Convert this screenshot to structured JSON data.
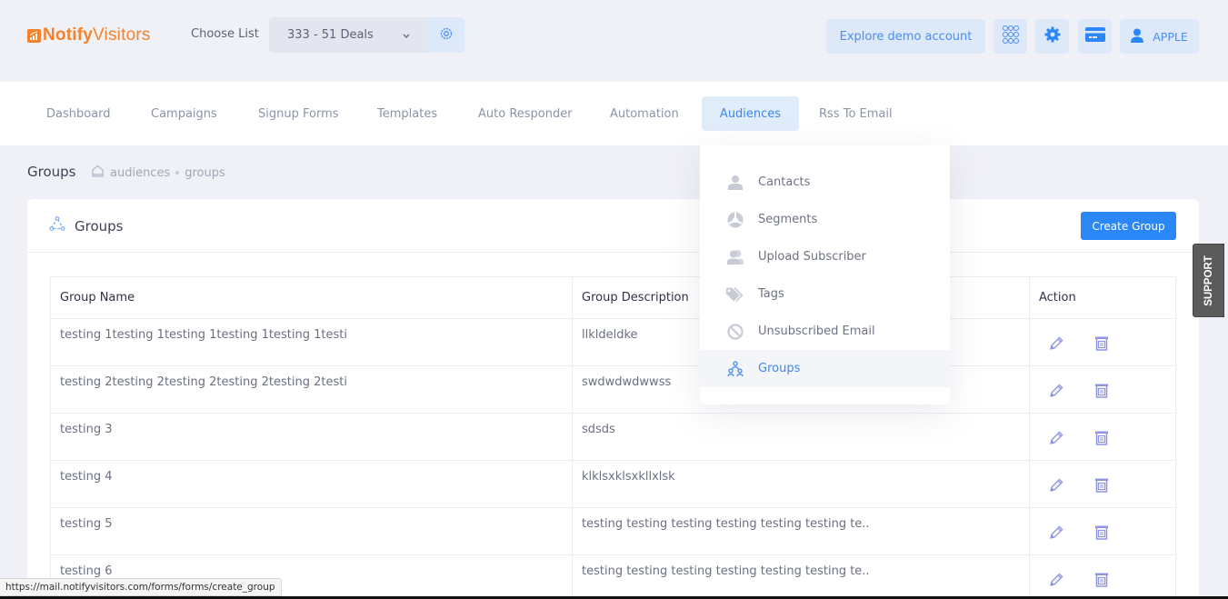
{
  "header": {
    "logo": {
      "bold": "Notify",
      "light": "Visitors",
      "color": "#f5822a"
    },
    "choose_list_label": "Choose List",
    "list_selected": "333 - 51 Deals",
    "demo_button": "Explore demo account",
    "user_name": "APPLE"
  },
  "nav": {
    "items": [
      {
        "label": "Dashboard"
      },
      {
        "label": "Campaigns"
      },
      {
        "label": "Signup Forms"
      },
      {
        "label": "Templates"
      },
      {
        "label": "Auto Responder"
      },
      {
        "label": "Automation"
      },
      {
        "label": "Audiences",
        "active": true
      },
      {
        "label": "Rss To Email"
      }
    ]
  },
  "audiences_menu": {
    "items": [
      {
        "label": "Cantacts",
        "icon": "user-icon"
      },
      {
        "label": "Segments",
        "icon": "segments-icon"
      },
      {
        "label": "Upload Subscriber",
        "icon": "users-icon"
      },
      {
        "label": "Tags",
        "icon": "tags-icon"
      },
      {
        "label": "Unsubscribed Email",
        "icon": "ban-icon"
      },
      {
        "label": "Groups",
        "icon": "groups-icon",
        "active": true
      }
    ]
  },
  "page": {
    "title": "Groups",
    "breadcrumb": [
      "audiences",
      "groups"
    ]
  },
  "card": {
    "title": "Groups",
    "create_button": "Create Group",
    "table": {
      "columns": [
        "Group Name",
        "Group Description",
        "Action"
      ],
      "rows": [
        {
          "name": "testing 1testing 1testing 1testing 1testing 1testi",
          "description": "llkldeldke"
        },
        {
          "name": "testing 2testing 2testing 2testing 2testing 2testi",
          "description": "swdwdwdwwss"
        },
        {
          "name": "testing 3",
          "description": "sdsds"
        },
        {
          "name": "testing 4",
          "description": "klklsxklsxkllxlsk"
        },
        {
          "name": "testing 5",
          "description": "testing testing testing testing testing testing te.."
        },
        {
          "name": "testing 6",
          "description": "testing testing testing testing testing testing te.."
        }
      ]
    }
  },
  "support_tab": "SUPPORT",
  "status_bar_url": "https://mail.notifyvisitors.com/forms/forms/create_group",
  "colors": {
    "accent": "#2b87f5",
    "accent_light": "#dde8f8",
    "brand": "#f5822a",
    "action_icon": "#8f95e0"
  }
}
